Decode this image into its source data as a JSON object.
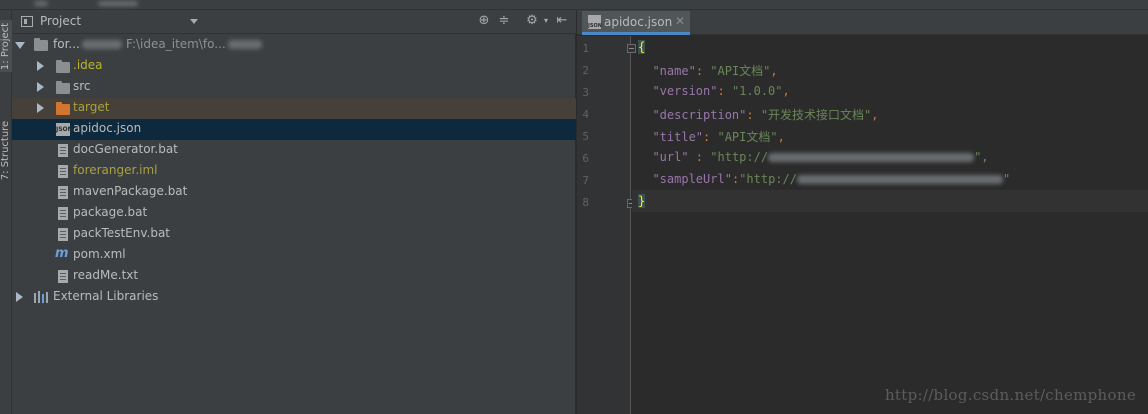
{
  "left_strip": {
    "project_tab": "1: Project",
    "structure_tab": "7: Structure"
  },
  "project_panel": {
    "title": "Project",
    "root": {
      "name": "for...",
      "path": "F:\\idea_item\\fo..."
    },
    "items": [
      {
        "label": ".idea",
        "kind": "folder",
        "color": "yellow"
      },
      {
        "label": "src",
        "kind": "folder",
        "color": "normal"
      },
      {
        "label": "target",
        "kind": "folder-excluded",
        "color": "olive"
      },
      {
        "label": "apidoc.json",
        "kind": "json",
        "color": "normal",
        "selected": true
      },
      {
        "label": "docGenerator.bat",
        "kind": "file",
        "color": "normal"
      },
      {
        "label": "foreranger.iml",
        "kind": "module",
        "color": "olive"
      },
      {
        "label": "mavenPackage.bat",
        "kind": "file",
        "color": "normal"
      },
      {
        "label": "package.bat",
        "kind": "file",
        "color": "normal"
      },
      {
        "label": "packTestEnv.bat",
        "kind": "file",
        "color": "normal"
      },
      {
        "label": "pom.xml",
        "kind": "maven",
        "color": "normal"
      },
      {
        "label": "readMe.txt",
        "kind": "file",
        "color": "normal"
      }
    ],
    "external_libraries": "External Libraries"
  },
  "editor": {
    "tab_label": "apidoc.json",
    "tab_icon_text": "JSON",
    "line_numbers": [
      "1",
      "2",
      "3",
      "4",
      "5",
      "6",
      "7",
      "8"
    ],
    "lines": [
      {
        "open": "{"
      },
      {
        "key": "\"name\"",
        "sep": ": ",
        "value": "\"API文档\"",
        "end": ","
      },
      {
        "key": "\"version\"",
        "sep": ": ",
        "value": "\"1.0.0\"",
        "end": ","
      },
      {
        "key": "\"description\"",
        "sep": ": ",
        "value": "\"开发技术接口文档\"",
        "end": ","
      },
      {
        "key": "\"title\"",
        "sep": ": ",
        "value": "\"API文档\"",
        "end": ","
      },
      {
        "key": "\"url\"",
        "sep": " : ",
        "value": "\"http://",
        "end": "\","
      },
      {
        "key": "\"sampleUrl\"",
        "sep": ":",
        "value": "\"http://",
        "end": "\""
      },
      {
        "close": "}"
      }
    ]
  },
  "watermark": "http://blog.csdn.net/chemphone",
  "colors": {
    "panel_bg": "#3c3f41",
    "editor_bg": "#2b2b2b",
    "selection": "#0d293e",
    "json_key": "#9876aa",
    "json_string": "#6a8759",
    "punctuation": "#cc7832"
  }
}
